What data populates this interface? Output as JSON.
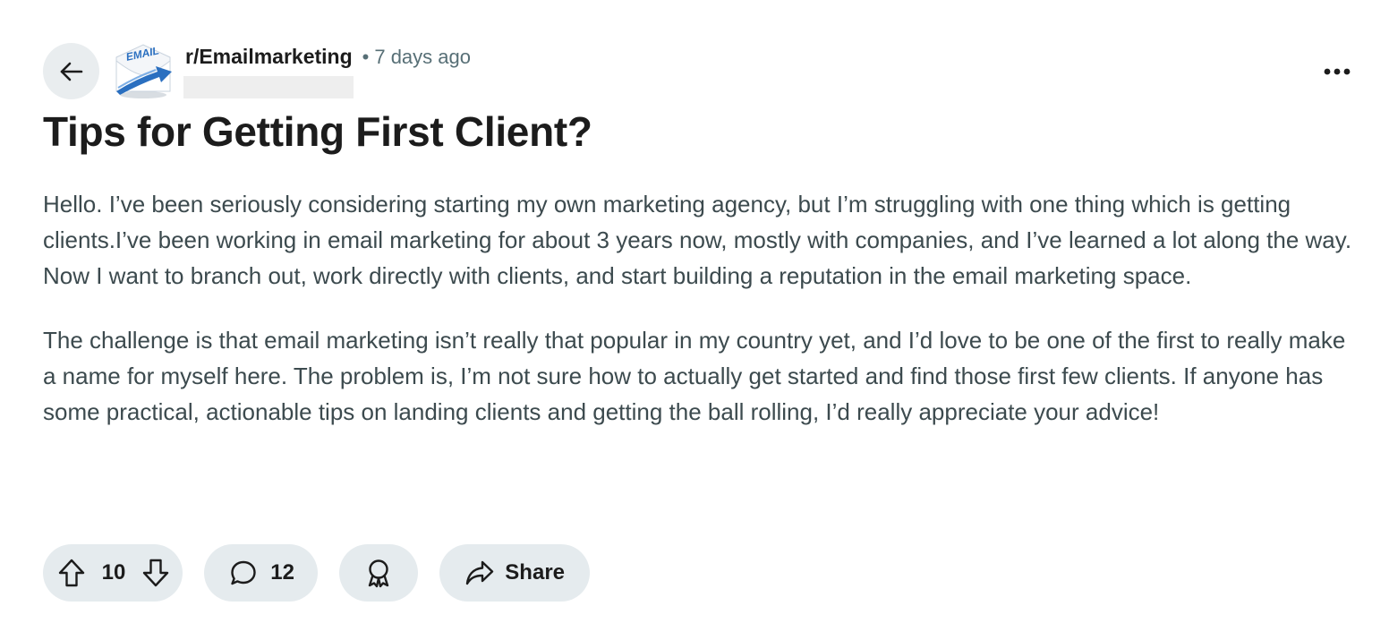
{
  "header": {
    "subreddit": "r/Emailmarketing",
    "separator": "•",
    "timestamp": "7 days ago",
    "avatar_text": "EMAIL",
    "icons": {
      "back": "arrow-left-icon",
      "more": "more-horizontal-icon"
    }
  },
  "post": {
    "title": "Tips for Getting First Client?",
    "paragraphs": [
      "Hello. I’ve been seriously considering starting my own marketing agency, but I’m struggling with one thing which is getting clients.I’ve been working in email marketing for about 3 years now, mostly with companies, and I’ve learned a lot along the way. Now I want to branch out, work directly with clients, and start building a reputation in the email marketing space.",
      "The challenge is that email marketing isn’t really that popular in my country yet, and I’d love to be one of the first to really make a name for myself here. The problem is, I’m not sure how to actually get started and find those first few clients. If anyone has some practical, actionable tips on landing clients and getting the ball rolling, I’d really appreciate your advice!"
    ]
  },
  "actions": {
    "vote_count": "10",
    "comment_count": "12",
    "share_label": "Share",
    "icons": {
      "upvote": "upvote-arrow-icon",
      "downvote": "downvote-arrow-icon",
      "comment": "comment-bubble-icon",
      "award": "award-ribbon-icon",
      "share": "share-arrow-icon"
    }
  },
  "colors": {
    "text_primary": "#1c1c1c",
    "text_body": "#3c4a4e",
    "text_meta": "#576f76",
    "pill_bg": "#e5ebee",
    "avatar_blue": "#2a6fc0"
  }
}
